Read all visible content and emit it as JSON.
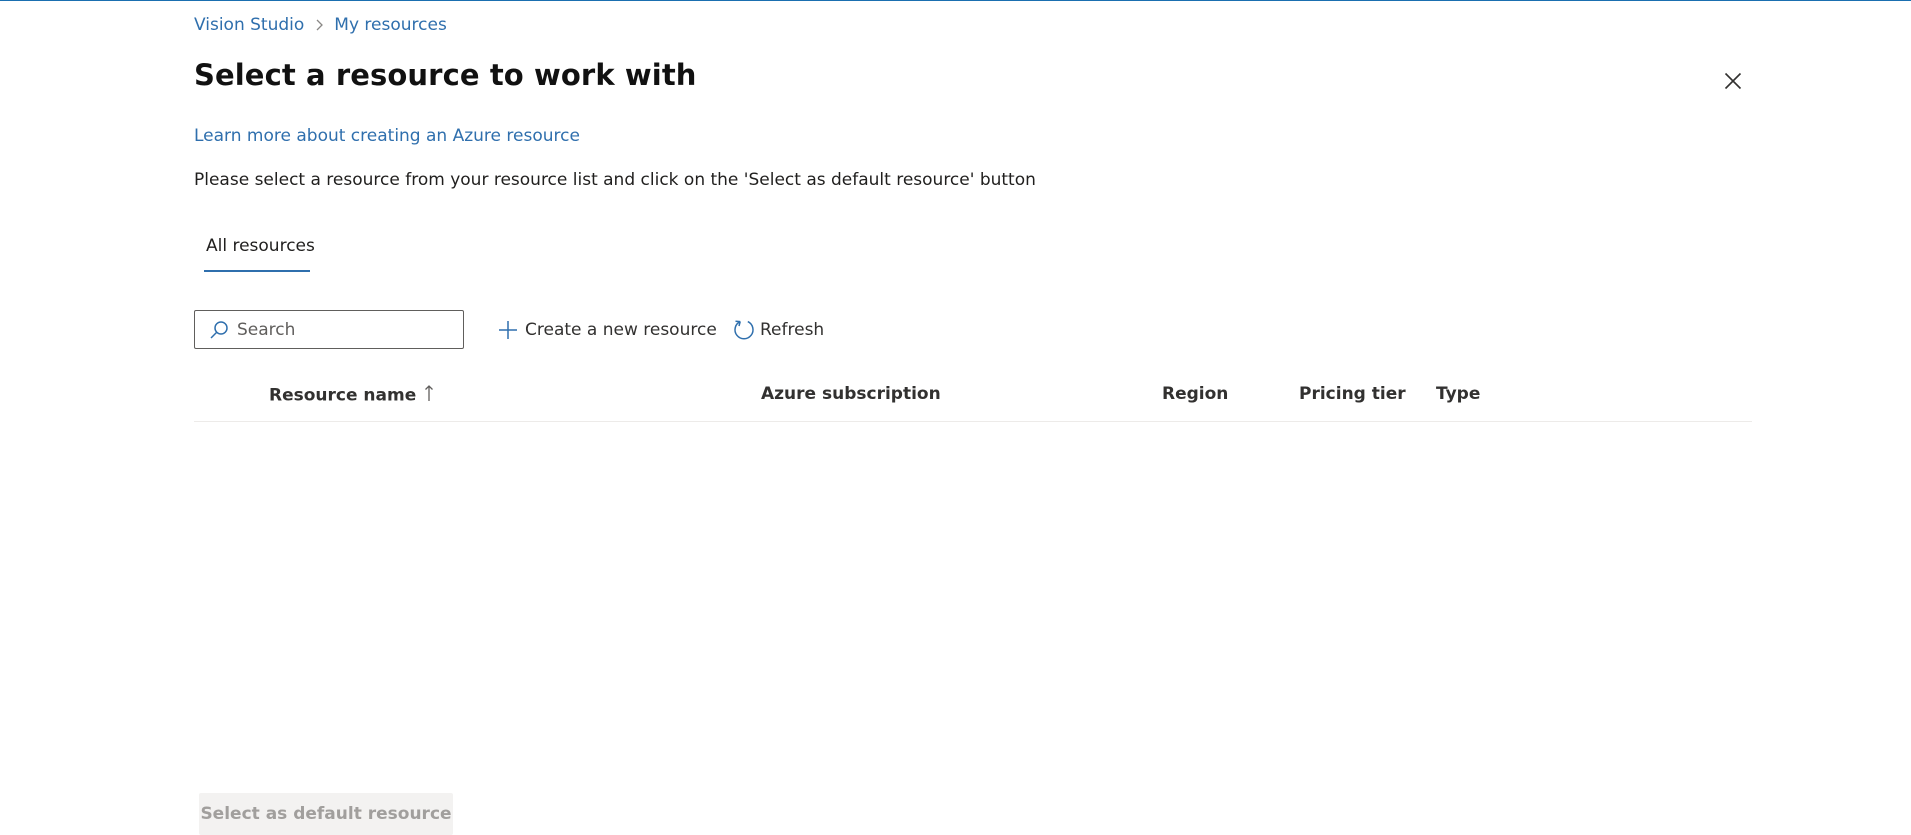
{
  "breadcrumb": {
    "items": [
      {
        "label": "Vision Studio"
      },
      {
        "label": "My resources"
      }
    ]
  },
  "page": {
    "title": "Select a resource to work with",
    "learn_link": "Learn more about creating an Azure resource",
    "instructions": "Please select a resource from your resource list and click on the 'Select as default resource' button"
  },
  "tabs": [
    {
      "label": "All resources",
      "selected": true
    }
  ],
  "toolbar": {
    "search_placeholder": "Search",
    "search_value": "",
    "create_label": "Create a new resource",
    "refresh_label": "Refresh"
  },
  "table": {
    "columns": [
      {
        "label": "Resource name",
        "sort": "ascending"
      },
      {
        "label": "Azure subscription"
      },
      {
        "label": "Region"
      },
      {
        "label": "Pricing tier"
      },
      {
        "label": "Type"
      }
    ],
    "rows": []
  },
  "footer": {
    "default_button_label": "Select as default resource",
    "default_button_enabled": false
  },
  "icons": {
    "breadcrumb_separator": "chevron-right-icon",
    "close": "close-icon",
    "search": "search-icon",
    "create": "plus-icon",
    "refresh": "refresh-icon",
    "sort": "arrow-up-icon"
  },
  "colors": {
    "accent": "#2f6fad",
    "top_border": "#1a6fb0",
    "disabled_button_bg": "#f3f2f1",
    "disabled_button_text": "#a19f9d"
  }
}
